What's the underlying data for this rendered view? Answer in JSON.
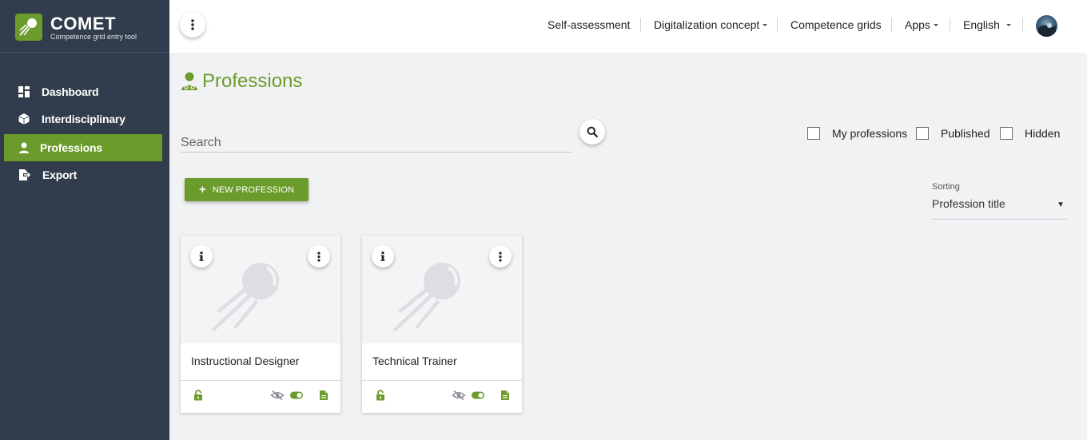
{
  "brand": {
    "name": "COMET",
    "subtitle": "Competence grid entry tool",
    "accent": "#6b9b2a",
    "sidebar_bg": "#313d4c"
  },
  "sidebar": {
    "items": [
      {
        "label": "Dashboard",
        "icon": "dashboard-icon",
        "active": false
      },
      {
        "label": "Interdisciplinary",
        "icon": "cube-icon",
        "active": false
      },
      {
        "label": "Professions",
        "icon": "user-icon",
        "active": true
      },
      {
        "label": "Export",
        "icon": "export-icon",
        "active": false
      }
    ]
  },
  "topbar": {
    "menu_icon": "kebab-icon",
    "items": [
      {
        "label": "Self-assessment",
        "dropdown": false
      },
      {
        "label": "Digitalization concept",
        "dropdown": true
      },
      {
        "label": "Competence grids",
        "dropdown": false
      },
      {
        "label": "Apps",
        "dropdown": true
      },
      {
        "label": "English",
        "dropdown": true
      }
    ],
    "avatar": "avatar-icon"
  },
  "page": {
    "title": "Professions",
    "title_icon": "professional-user-icon"
  },
  "search": {
    "placeholder": "Search",
    "value": "",
    "button_icon": "search-icon"
  },
  "filters": [
    {
      "label": "My professions",
      "checked": false
    },
    {
      "label": "Published",
      "checked": false
    },
    {
      "label": "Hidden",
      "checked": false
    }
  ],
  "new_button": {
    "label": "NEW PROFESSION",
    "icon": "plus-icon"
  },
  "sorting": {
    "label": "Sorting",
    "value": "Profession title"
  },
  "cards": [
    {
      "title": "Instructional Designer",
      "placeholder_icon": "comet-logo-icon",
      "info_icon": "info-icon",
      "menu_icon": "kebab-icon",
      "footer_icons": [
        "unlock-icon",
        "eye-slash-icon",
        "toggle-on-icon",
        "document-icon"
      ]
    },
    {
      "title": "Technical Trainer",
      "placeholder_icon": "comet-logo-icon",
      "info_icon": "info-icon",
      "menu_icon": "kebab-icon",
      "footer_icons": [
        "unlock-icon",
        "eye-slash-icon",
        "toggle-on-icon",
        "document-icon"
      ]
    }
  ]
}
